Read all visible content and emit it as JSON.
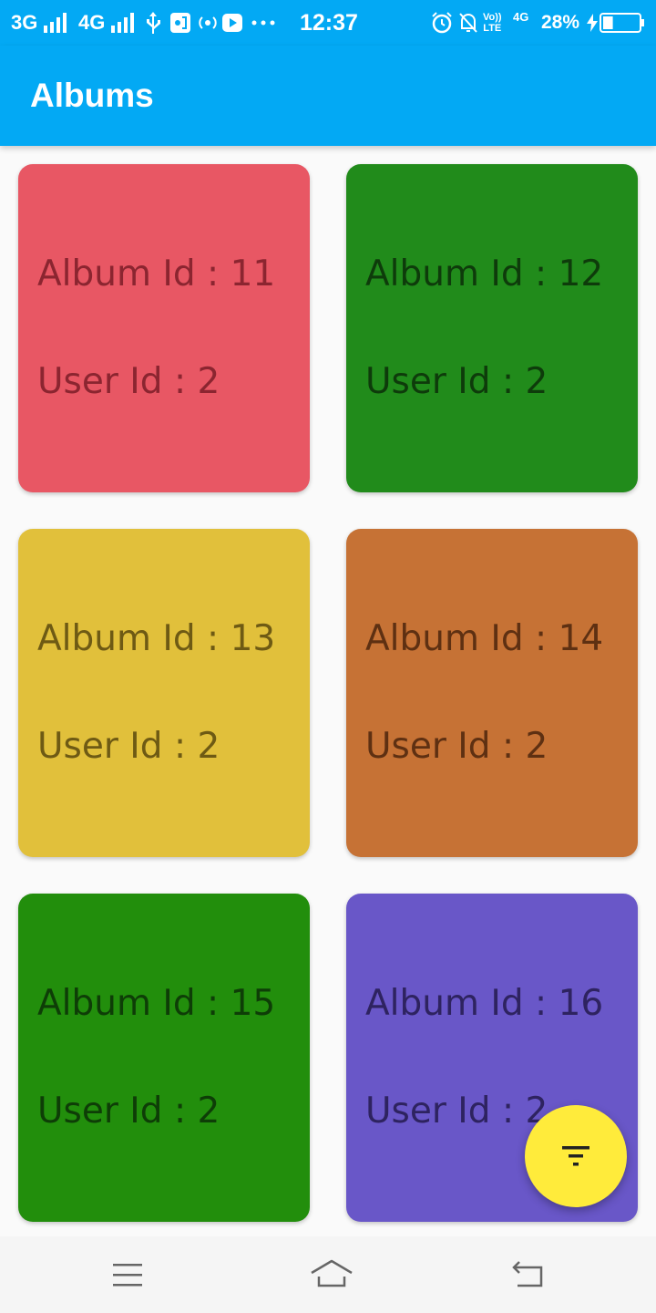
{
  "status_bar": {
    "network1": "3G",
    "network2": "4G",
    "time": "12:37",
    "volte_top": "Vo))",
    "volte_bottom": "LTE",
    "network3": "4G",
    "battery_percent": "28%",
    "battery_level": 0.28,
    "icons": [
      "signal-icon",
      "usb-icon",
      "cast-icon",
      "hotspot-icon",
      "youtube-icon",
      "more-dots-icon",
      "alarm-icon",
      "mute-notification-icon",
      "charging-icon",
      "battery-icon"
    ]
  },
  "app_bar": {
    "title": "Albums"
  },
  "albums": [
    {
      "album_label": "Album Id : 11",
      "user_label": "User Id : 2",
      "bg": "#e85764",
      "fg": "#8b2530"
    },
    {
      "album_label": "Album Id : 12",
      "user_label": "User Id : 2",
      "bg": "#218b1b",
      "fg": "#0e3b0b"
    },
    {
      "album_label": "Album Id : 13",
      "user_label": "User Id : 2",
      "bg": "#e1c03b",
      "fg": "#6e5a14"
    },
    {
      "album_label": "Album Id : 14",
      "user_label": "User Id : 2",
      "bg": "#c67235",
      "fg": "#5e3012"
    },
    {
      "album_label": "Album Id : 15",
      "user_label": "User Id : 2",
      "bg": "#228e0c",
      "fg": "#0e3d07"
    },
    {
      "album_label": "Album Id : 16",
      "user_label": "User Id : 2",
      "bg": "#6957c8",
      "fg": "#2e2360"
    }
  ],
  "fab": {
    "icon": "filter-icon",
    "color": "#ffeb3b"
  },
  "nav_bar": {
    "icons": [
      "menu-icon",
      "home-icon",
      "back-icon"
    ]
  },
  "colors": {
    "primary": "#03a9f4",
    "background": "#fafafa"
  }
}
